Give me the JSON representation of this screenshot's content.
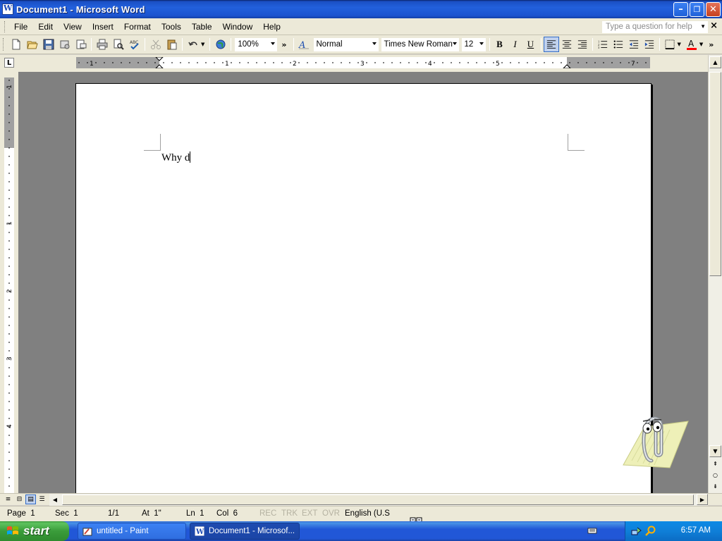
{
  "window": {
    "title": "Document1 - Microsoft Word",
    "minimize_glyph": "–",
    "restore_glyph": "❐",
    "close_glyph": "✕"
  },
  "menu": {
    "items": [
      "File",
      "Edit",
      "View",
      "Insert",
      "Format",
      "Tools",
      "Table",
      "Window",
      "Help"
    ],
    "help_placeholder": "Type a question for help"
  },
  "toolbar": {
    "zoom": "100%",
    "style": "Normal",
    "font": "Times New Roman",
    "size": "12",
    "bold": "B",
    "italic": "I",
    "underline": "U",
    "font_color": "#ff0000"
  },
  "ruler": {
    "h_labels": [
      "1",
      "1",
      "2",
      "3",
      "4",
      "5",
      "7"
    ],
    "v_labels": [
      "1",
      "1",
      "2",
      "3",
      "4"
    ]
  },
  "document": {
    "text": "Why d"
  },
  "status": {
    "page": "Page  1",
    "sec": "Sec  1",
    "pages": "1/1",
    "at": "At  1\"",
    "ln": "Ln  1",
    "col": "Col  6",
    "rec": "REC",
    "trk": "TRK",
    "ext": "EXT",
    "ovr": "OVR",
    "language": "English (U.S"
  },
  "taskbar": {
    "start": "start",
    "tasks": [
      {
        "label": "untitled - Paint",
        "active": false
      },
      {
        "label": "Document1 - Microsof...",
        "active": true
      }
    ],
    "clock": "6:57 AM"
  }
}
